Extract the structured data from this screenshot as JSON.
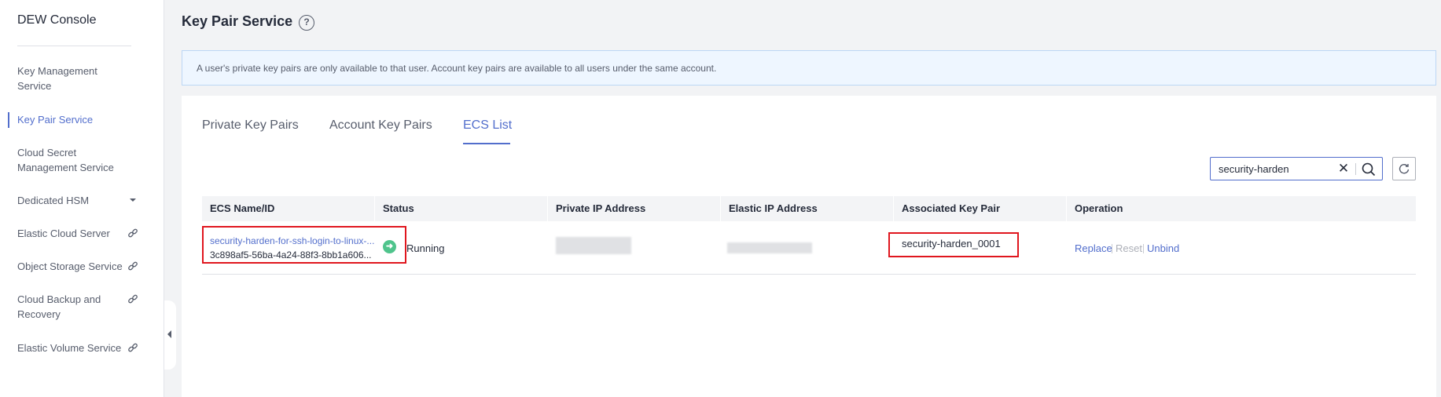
{
  "sidebar": {
    "title": "DEW Console",
    "items": [
      {
        "label": "Key Management Service"
      },
      {
        "label": "Key Pair Service"
      },
      {
        "label": "Cloud Secret Management Service"
      },
      {
        "label": "Dedicated HSM",
        "icon": "chevron-down-icon"
      },
      {
        "label": "Elastic Cloud Server",
        "icon": "link-icon"
      },
      {
        "label": "Object Storage Service",
        "icon": "link-icon"
      },
      {
        "label": "Cloud Backup and Recovery",
        "icon": "link-icon"
      },
      {
        "label": "Elastic Volume Service",
        "icon": "link-icon"
      }
    ],
    "active_item": "Key Pair Service"
  },
  "header": {
    "title": "Key Pair Service",
    "help_glyph": "?"
  },
  "info_banner": {
    "text": "A user's private key pairs are only available to that user. Account key pairs are available to all users under the same account."
  },
  "tabs": [
    {
      "label": "Private Key Pairs"
    },
    {
      "label": "Account Key Pairs"
    },
    {
      "label": "ECS List"
    }
  ],
  "active_tab": "ECS List",
  "search": {
    "value": "security-harden"
  },
  "table": {
    "columns": [
      "ECS Name/ID",
      "Status",
      "Private IP Address",
      "Elastic IP Address",
      "Associated Key Pair",
      "Operation"
    ],
    "rows": [
      {
        "name": "security-harden-for-ssh-login-to-linux-...",
        "id": "3c898af5-56ba-4a24-88f3-8bb1a606...",
        "status": "Running",
        "associated_key_pair": "security-harden_0001",
        "operations": {
          "replace": "Replace",
          "reset": "Reset",
          "unbind": "Unbind"
        }
      }
    ]
  },
  "colors": {
    "accent": "#526ecc",
    "highlight": "#e0161e",
    "status_running": "#4fc48c"
  }
}
